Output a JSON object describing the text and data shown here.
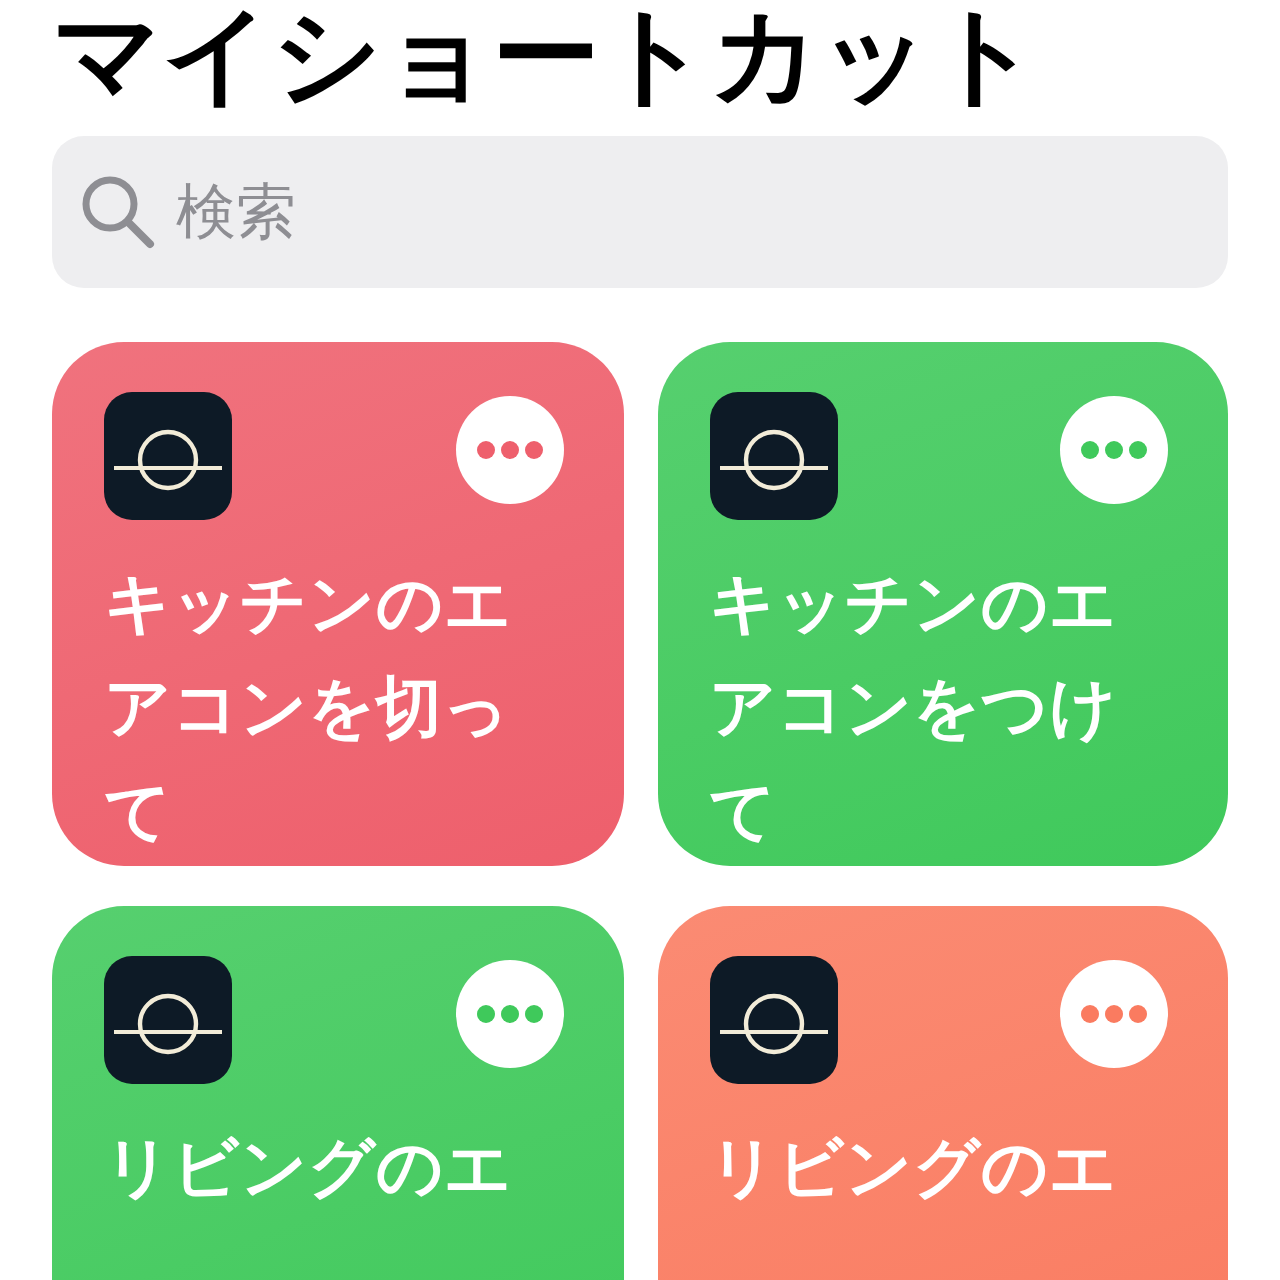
{
  "title": "マイショートカット",
  "search": {
    "placeholder": "検索"
  },
  "shortcuts": [
    {
      "name": "キッチンのエアコンを切って",
      "color": "#ee5f6c"
    },
    {
      "name": "キッチンのエアコンをつけて",
      "color": "#3fc95b"
    },
    {
      "name": "リビングのエ",
      "color": "#3fc95b"
    },
    {
      "name": "リビングのエ",
      "color": "#fa7b60"
    }
  ]
}
